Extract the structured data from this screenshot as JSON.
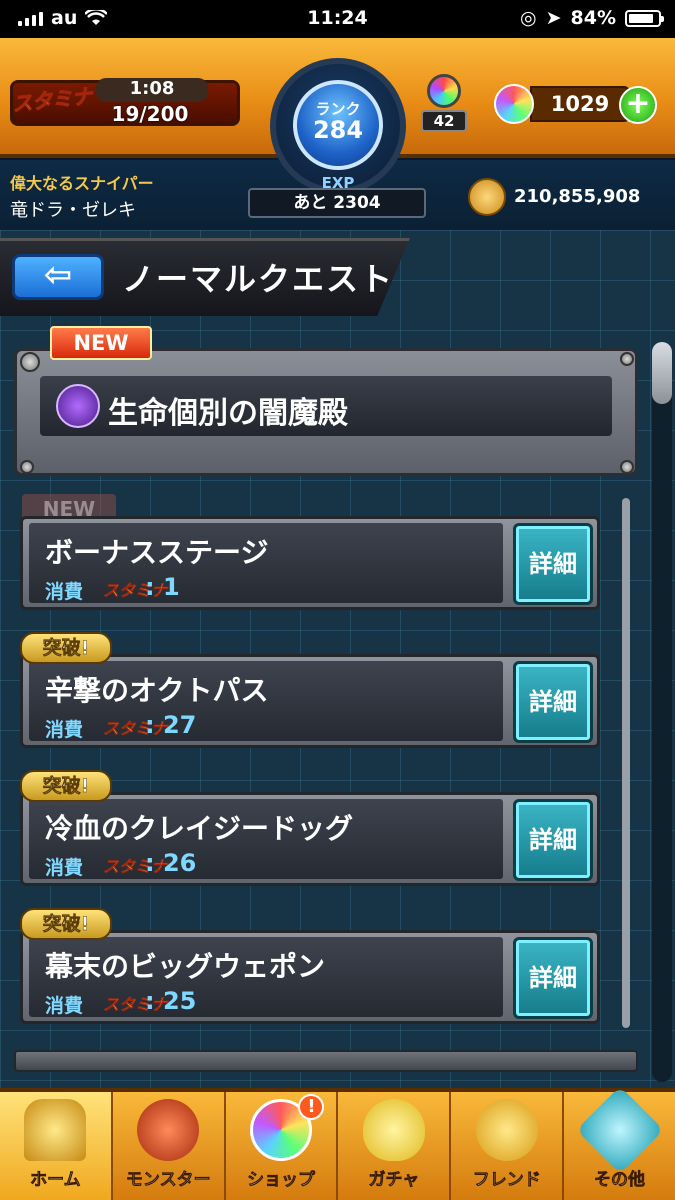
{
  "status_bar": {
    "carrier": "au",
    "time": "11:24",
    "battery": "84%"
  },
  "header": {
    "stamina_tag": "スタミナ",
    "stamina_timer": "1:08",
    "stamina_value": "19/200",
    "rank_label": "ランク",
    "rank_value": "284",
    "exp_label": "EXP",
    "exp_remaining": "あと 2304",
    "egg_count": "42",
    "orb_count": "1029",
    "player_title": "偉大なるスナイパー",
    "player_name": "竜ドラ・ゼレキ",
    "coin_count": "210,855,908"
  },
  "page": {
    "title": "ノーマルクエスト",
    "back_symbol": "⇦"
  },
  "featured": {
    "badge": "NEW",
    "title": "生命個別の闇魔殿"
  },
  "quests": [
    {
      "badge": "NEW",
      "name": "ボーナスステージ",
      "cost_label": "消費",
      "stamina": "スタミナ",
      "cost": ": 1",
      "detail": "詳細"
    },
    {
      "badge": "突破!",
      "name": "辛撃のオクトパス",
      "cost_label": "消費",
      "stamina": "スタミナ",
      "cost": ": 27",
      "detail": "詳細"
    },
    {
      "badge": "突破!",
      "name": "冷血のクレイジードッグ",
      "cost_label": "消費",
      "stamina": "スタミナ",
      "cost": ": 26",
      "detail": "詳細"
    },
    {
      "badge": "突破!",
      "name": "幕末のビッグウェポン",
      "cost_label": "消費",
      "stamina": "スタミナ",
      "cost": ": 25",
      "detail": "詳細"
    }
  ],
  "nav": [
    {
      "label": "ホーム",
      "icon": "home-icon",
      "color": "#f6c23a"
    },
    {
      "label": "モンスター",
      "icon": "monster-icon",
      "color": "#d9532b"
    },
    {
      "label": "ショップ",
      "icon": "shop-orb-icon",
      "color": "#7fd8ff"
    },
    {
      "label": "ガチャ",
      "icon": "gacha-egg-icon",
      "color": "#f6e23a"
    },
    {
      "label": "フレンド",
      "icon": "friend-icon",
      "color": "#f6c23a"
    },
    {
      "label": "その他",
      "icon": "other-icon",
      "color": "#6fd8e6"
    }
  ],
  "shop_alert": "!",
  "colors": {
    "header_orange": "#e98d16",
    "detail_teal": "#2a9aa9",
    "cost_cyan": "#7fd8ff",
    "new_red": "#d8290c",
    "breakthrough_gold": "#d9ab2e"
  }
}
